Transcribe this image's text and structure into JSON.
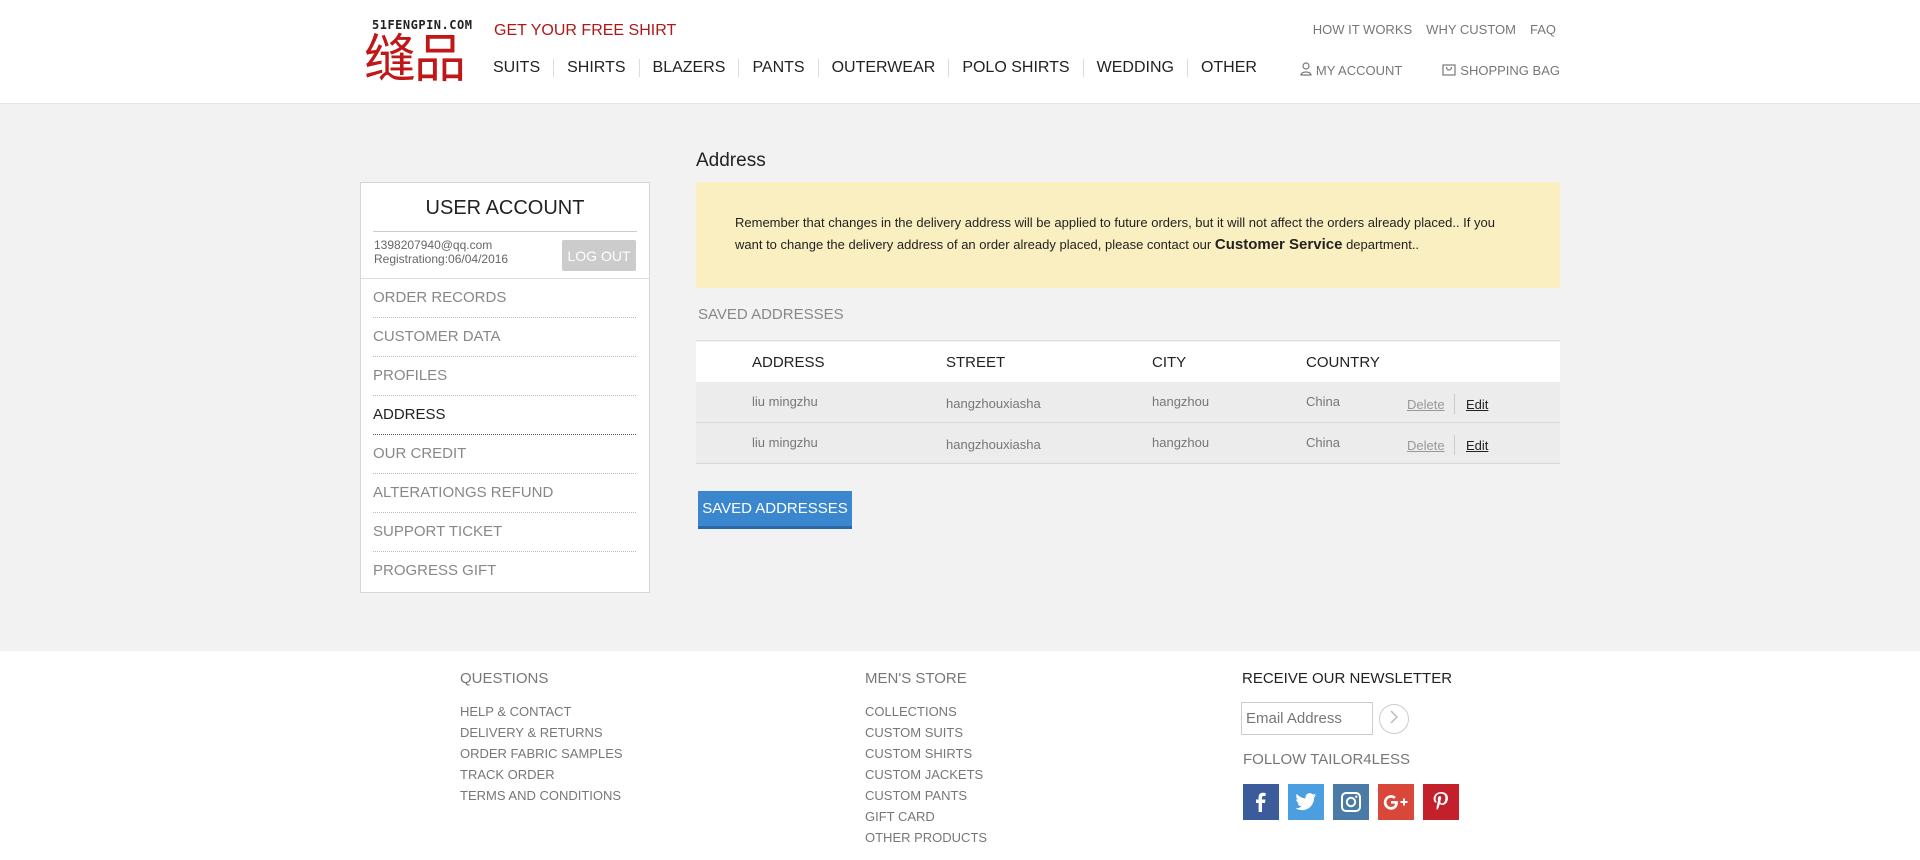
{
  "header": {
    "logo_en": "51FENGPIN.COM",
    "logo_cn": "缝品",
    "promo": "GET YOUR FREE SHIRT",
    "top_links": [
      "HOW IT WORKS",
      "WHY CUSTOM",
      "FAQ"
    ],
    "nav": [
      "SUITS",
      "SHIRTS",
      "BLAZERS",
      "PANTS",
      "OUTERWEAR",
      "POLO SHIRTS",
      "WEDDING",
      "OTHER"
    ],
    "my_account": "MY ACCOUNT",
    "shopping_bag": "SHOPPING BAG"
  },
  "sidebar": {
    "title": "USER ACCOUNT",
    "email": "1398207940@qq.com",
    "registration": "Registrationg:06/04/2016",
    "logout": "LOG OUT",
    "items": [
      "ORDER RECORDS",
      "CUSTOMER DATA",
      "PROFILES",
      "ADDRESS",
      "OUR CREDIT",
      "ALTERATIONGS REFUND",
      "SUPPORT TICKET",
      "PROGRESS GIFT"
    ],
    "active_item": "ADDRESS"
  },
  "main": {
    "title": "Address",
    "notice_before": "Remember that changes in the delivery address will be applied to future orders, but it will not affect the orders already placed.. If you want to change the delivery address of an order already placed, please contact our",
    "notice_link": "Customer Service",
    "notice_after": "department..",
    "saved_label": "SAVED ADDRESSES",
    "table": {
      "headers": [
        "ADDRESS",
        "STREET",
        "CITY",
        "COUNTRY"
      ],
      "rows": [
        {
          "address": "liu mingzhu",
          "street": "hangzhouxiasha",
          "city": "hangzhou",
          "country": "China",
          "delete": "Delete",
          "edit": "Edit"
        },
        {
          "address": "liu mingzhu",
          "street": "hangzhouxiasha",
          "city": "hangzhou",
          "country": "China",
          "delete": "Delete",
          "edit": "Edit"
        }
      ]
    },
    "button": "SAVED ADDRESSES"
  },
  "footer": {
    "questions": {
      "title": "QUESTIONS",
      "links": [
        "HELP & CONTACT",
        "DELIVERY & RETURNS",
        "ORDER FABRIC SAMPLES",
        "TRACK ORDER",
        "TERMS AND CONDITIONS"
      ]
    },
    "store": {
      "title": "MEN'S STORE",
      "links": [
        "COLLECTIONS",
        "CUSTOM SUITS",
        "CUSTOM SHIRTS",
        "CUSTOM JACKETS",
        "CUSTOM PANTS",
        "GIFT CARD",
        "OTHER PRODUCTS"
      ]
    },
    "newsletter_title": "RECEIVE OUR NEWSLETTER",
    "email_placeholder": "Email Address",
    "follow_title": "FOLLOW TAILOR4LESS",
    "social": [
      {
        "name": "facebook-icon",
        "color": "#3b5b9a"
      },
      {
        "name": "twitter-icon",
        "color": "#4b9fe0"
      },
      {
        "name": "instagram-icon",
        "color": "#4a7aa6"
      },
      {
        "name": "google-plus-icon",
        "color": "#d9463a"
      },
      {
        "name": "pinterest-icon",
        "color": "#c4202b"
      }
    ]
  },
  "colors": {
    "accent": "#3a87d0",
    "brand": "#c01818",
    "notice_bg": "#faefc0"
  }
}
